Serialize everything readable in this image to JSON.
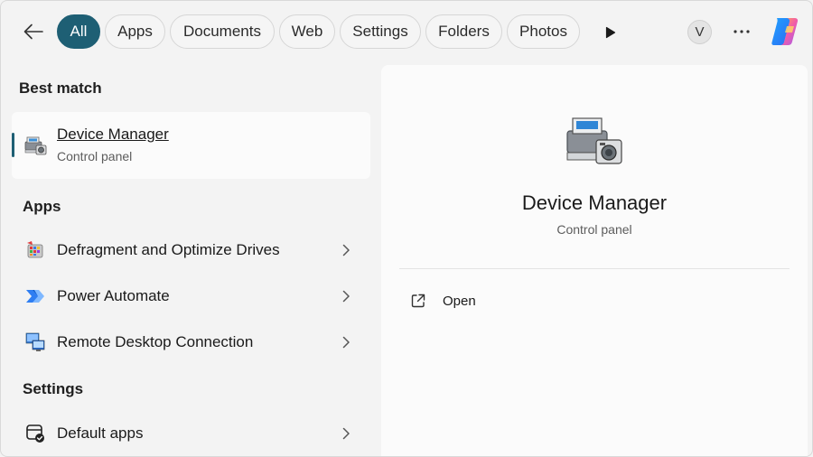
{
  "header": {
    "back_icon": "arrow-left-icon",
    "tabs": [
      {
        "label": "All",
        "active": true
      },
      {
        "label": "Apps",
        "active": false
      },
      {
        "label": "Documents",
        "active": false
      },
      {
        "label": "Web",
        "active": false
      },
      {
        "label": "Settings",
        "active": false
      },
      {
        "label": "Folders",
        "active": false
      },
      {
        "label": "Photos",
        "active": false
      }
    ],
    "more_tabs_icon": "play-icon",
    "avatar_initial": "V",
    "more_icon": "ellipsis-icon",
    "copilot_icon": "copilot-icon",
    "accent_color": "#1e5f74"
  },
  "results": {
    "best_match_title": "Best match",
    "best_match": {
      "name": "Device Manager",
      "type": "Control panel",
      "icon": "device-manager-icon"
    },
    "apps_title": "Apps",
    "apps": [
      {
        "name": "Defragment and Optimize Drives",
        "icon": "defragment-icon"
      },
      {
        "name": "Power Automate",
        "icon": "power-automate-icon"
      },
      {
        "name": "Remote Desktop Connection",
        "icon": "remote-desktop-icon"
      }
    ],
    "settings_title": "Settings",
    "settings": [
      {
        "name": "Default apps",
        "icon": "default-apps-icon"
      }
    ]
  },
  "detail": {
    "title": "Device Manager",
    "subtitle": "Control panel",
    "actions": [
      {
        "label": "Open",
        "icon": "open-external-icon"
      }
    ]
  }
}
